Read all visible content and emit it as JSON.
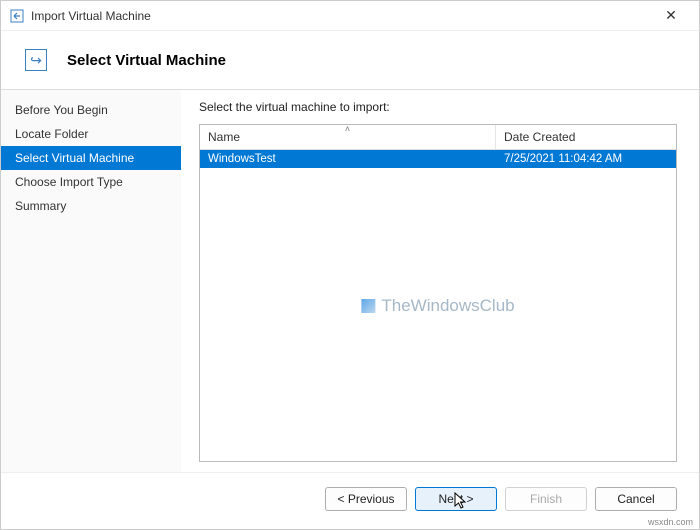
{
  "window": {
    "title": "Import Virtual Machine",
    "close_glyph": "✕"
  },
  "header": {
    "icon_glyph": "↪",
    "title": "Select Virtual Machine"
  },
  "sidebar": {
    "items": [
      {
        "label": "Before You Begin",
        "active": false
      },
      {
        "label": "Locate Folder",
        "active": false
      },
      {
        "label": "Select Virtual Machine",
        "active": true
      },
      {
        "label": "Choose Import Type",
        "active": false
      },
      {
        "label": "Summary",
        "active": false
      }
    ]
  },
  "main": {
    "instruction": "Select the virtual machine to import:",
    "columns": {
      "name": "Name",
      "date": "Date Created",
      "sort_glyph": "˄"
    },
    "rows": [
      {
        "name": "WindowsTest",
        "date": "7/25/2021 11:04:42 AM",
        "selected": true
      }
    ]
  },
  "watermark": {
    "text": "TheWindowsClub"
  },
  "footer": {
    "previous": "< Previous",
    "next": "Next >",
    "finish": "Finish",
    "cancel": "Cancel"
  },
  "attribution": "wsxdn.com"
}
